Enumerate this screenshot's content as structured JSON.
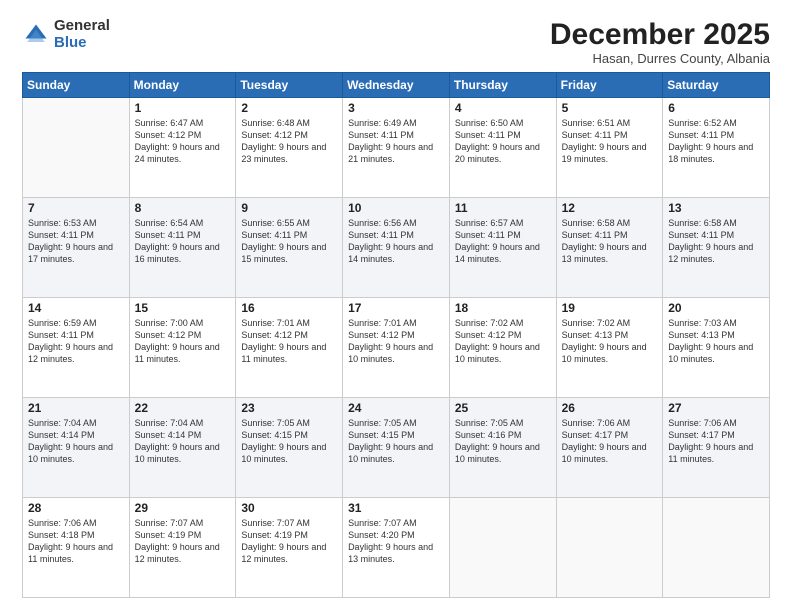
{
  "logo": {
    "general": "General",
    "blue": "Blue"
  },
  "header": {
    "month": "December 2025",
    "location": "Hasan, Durres County, Albania"
  },
  "weekdays": [
    "Sunday",
    "Monday",
    "Tuesday",
    "Wednesday",
    "Thursday",
    "Friday",
    "Saturday"
  ],
  "weeks": [
    [
      {
        "day": null
      },
      {
        "day": 1,
        "sunrise": "6:47 AM",
        "sunset": "4:12 PM",
        "daylight": "9 hours and 24 minutes."
      },
      {
        "day": 2,
        "sunrise": "6:48 AM",
        "sunset": "4:12 PM",
        "daylight": "9 hours and 23 minutes."
      },
      {
        "day": 3,
        "sunrise": "6:49 AM",
        "sunset": "4:11 PM",
        "daylight": "9 hours and 21 minutes."
      },
      {
        "day": 4,
        "sunrise": "6:50 AM",
        "sunset": "4:11 PM",
        "daylight": "9 hours and 20 minutes."
      },
      {
        "day": 5,
        "sunrise": "6:51 AM",
        "sunset": "4:11 PM",
        "daylight": "9 hours and 19 minutes."
      },
      {
        "day": 6,
        "sunrise": "6:52 AM",
        "sunset": "4:11 PM",
        "daylight": "9 hours and 18 minutes."
      }
    ],
    [
      {
        "day": 7,
        "sunrise": "6:53 AM",
        "sunset": "4:11 PM",
        "daylight": "9 hours and 17 minutes."
      },
      {
        "day": 8,
        "sunrise": "6:54 AM",
        "sunset": "4:11 PM",
        "daylight": "9 hours and 16 minutes."
      },
      {
        "day": 9,
        "sunrise": "6:55 AM",
        "sunset": "4:11 PM",
        "daylight": "9 hours and 15 minutes."
      },
      {
        "day": 10,
        "sunrise": "6:56 AM",
        "sunset": "4:11 PM",
        "daylight": "9 hours and 14 minutes."
      },
      {
        "day": 11,
        "sunrise": "6:57 AM",
        "sunset": "4:11 PM",
        "daylight": "9 hours and 14 minutes."
      },
      {
        "day": 12,
        "sunrise": "6:58 AM",
        "sunset": "4:11 PM",
        "daylight": "9 hours and 13 minutes."
      },
      {
        "day": 13,
        "sunrise": "6:58 AM",
        "sunset": "4:11 PM",
        "daylight": "9 hours and 12 minutes."
      }
    ],
    [
      {
        "day": 14,
        "sunrise": "6:59 AM",
        "sunset": "4:11 PM",
        "daylight": "9 hours and 12 minutes."
      },
      {
        "day": 15,
        "sunrise": "7:00 AM",
        "sunset": "4:12 PM",
        "daylight": "9 hours and 11 minutes."
      },
      {
        "day": 16,
        "sunrise": "7:01 AM",
        "sunset": "4:12 PM",
        "daylight": "9 hours and 11 minutes."
      },
      {
        "day": 17,
        "sunrise": "7:01 AM",
        "sunset": "4:12 PM",
        "daylight": "9 hours and 10 minutes."
      },
      {
        "day": 18,
        "sunrise": "7:02 AM",
        "sunset": "4:12 PM",
        "daylight": "9 hours and 10 minutes."
      },
      {
        "day": 19,
        "sunrise": "7:02 AM",
        "sunset": "4:13 PM",
        "daylight": "9 hours and 10 minutes."
      },
      {
        "day": 20,
        "sunrise": "7:03 AM",
        "sunset": "4:13 PM",
        "daylight": "9 hours and 10 minutes."
      }
    ],
    [
      {
        "day": 21,
        "sunrise": "7:04 AM",
        "sunset": "4:14 PM",
        "daylight": "9 hours and 10 minutes."
      },
      {
        "day": 22,
        "sunrise": "7:04 AM",
        "sunset": "4:14 PM",
        "daylight": "9 hours and 10 minutes."
      },
      {
        "day": 23,
        "sunrise": "7:05 AM",
        "sunset": "4:15 PM",
        "daylight": "9 hours and 10 minutes."
      },
      {
        "day": 24,
        "sunrise": "7:05 AM",
        "sunset": "4:15 PM",
        "daylight": "9 hours and 10 minutes."
      },
      {
        "day": 25,
        "sunrise": "7:05 AM",
        "sunset": "4:16 PM",
        "daylight": "9 hours and 10 minutes."
      },
      {
        "day": 26,
        "sunrise": "7:06 AM",
        "sunset": "4:17 PM",
        "daylight": "9 hours and 10 minutes."
      },
      {
        "day": 27,
        "sunrise": "7:06 AM",
        "sunset": "4:17 PM",
        "daylight": "9 hours and 11 minutes."
      }
    ],
    [
      {
        "day": 28,
        "sunrise": "7:06 AM",
        "sunset": "4:18 PM",
        "daylight": "9 hours and 11 minutes."
      },
      {
        "day": 29,
        "sunrise": "7:07 AM",
        "sunset": "4:19 PM",
        "daylight": "9 hours and 12 minutes."
      },
      {
        "day": 30,
        "sunrise": "7:07 AM",
        "sunset": "4:19 PM",
        "daylight": "9 hours and 12 minutes."
      },
      {
        "day": 31,
        "sunrise": "7:07 AM",
        "sunset": "4:20 PM",
        "daylight": "9 hours and 13 minutes."
      },
      {
        "day": null
      },
      {
        "day": null
      },
      {
        "day": null
      }
    ]
  ]
}
